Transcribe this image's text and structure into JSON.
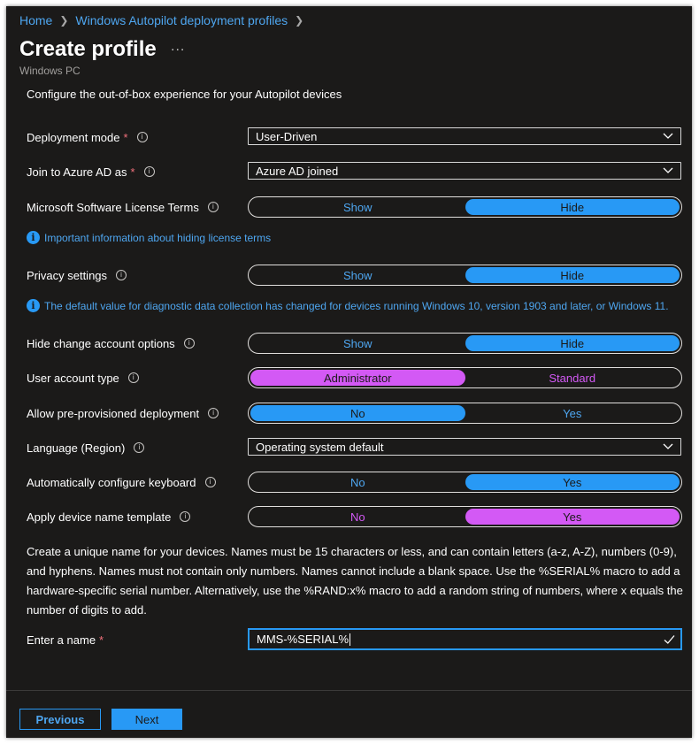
{
  "breadcrumb": [
    {
      "label": "Home"
    },
    {
      "label": "Windows Autopilot deployment profiles"
    }
  ],
  "page": {
    "title": "Create profile",
    "more": "...",
    "subtitle": "Windows PC",
    "intro": "Configure the out-of-box experience for your Autopilot devices"
  },
  "fields": {
    "deployment_mode": {
      "label": "Deployment mode",
      "required": "*",
      "value": "User-Driven"
    },
    "join_azure": {
      "label": "Join to Azure AD as",
      "required": "*",
      "value": "Azure AD joined"
    },
    "license_terms": {
      "label": "Microsoft Software License Terms",
      "options": [
        "Show",
        "Hide"
      ],
      "selected": "Hide"
    },
    "license_info": "Important information about hiding license terms",
    "privacy": {
      "label": "Privacy settings",
      "options": [
        "Show",
        "Hide"
      ],
      "selected": "Hide"
    },
    "privacy_info": "The default value for diagnostic data collection has changed for devices running Windows 10, version 1903 and later, or Windows 11.",
    "hide_change_account": {
      "label": "Hide change account options",
      "options": [
        "Show",
        "Hide"
      ],
      "selected": "Hide"
    },
    "user_account_type": {
      "label": "User account type",
      "options": [
        "Administrator",
        "Standard"
      ],
      "selected": "Administrator"
    },
    "pre_provisioned": {
      "label": "Allow pre-provisioned deployment",
      "options": [
        "No",
        "Yes"
      ],
      "selected": "No"
    },
    "language": {
      "label": "Language (Region)",
      "value": "Operating system default"
    },
    "auto_keyboard": {
      "label": "Automatically configure keyboard",
      "options": [
        "No",
        "Yes"
      ],
      "selected": "Yes"
    },
    "device_name_template": {
      "label": "Apply device name template",
      "options": [
        "No",
        "Yes"
      ],
      "selected": "Yes"
    },
    "name_description": "Create a unique name for your devices. Names must be 15 characters or less, and can contain letters (a-z, A-Z), numbers (0-9), and hyphens. Names must not contain only numbers. Names cannot include a blank space. Use the %SERIAL% macro to add a hardware-specific serial number. Alternatively, use the %RAND:x% macro to add a random string of numbers, where x equals the number of digits to add.",
    "enter_name": {
      "label": "Enter a name",
      "required": "*",
      "value": "MMS-%SERIAL%"
    }
  },
  "footer": {
    "previous": "Previous",
    "next": "Next"
  },
  "colors": {
    "background": "#1b1a19",
    "accent_blue": "#2899f5",
    "accent_pink": "#d359f5",
    "link": "#4ea6f0",
    "required": "#f1707b"
  },
  "icons": [
    "chevron-right-icon",
    "more-icon",
    "info-icon",
    "chevron-down-icon",
    "info-filled-icon",
    "checkmark-icon"
  ]
}
